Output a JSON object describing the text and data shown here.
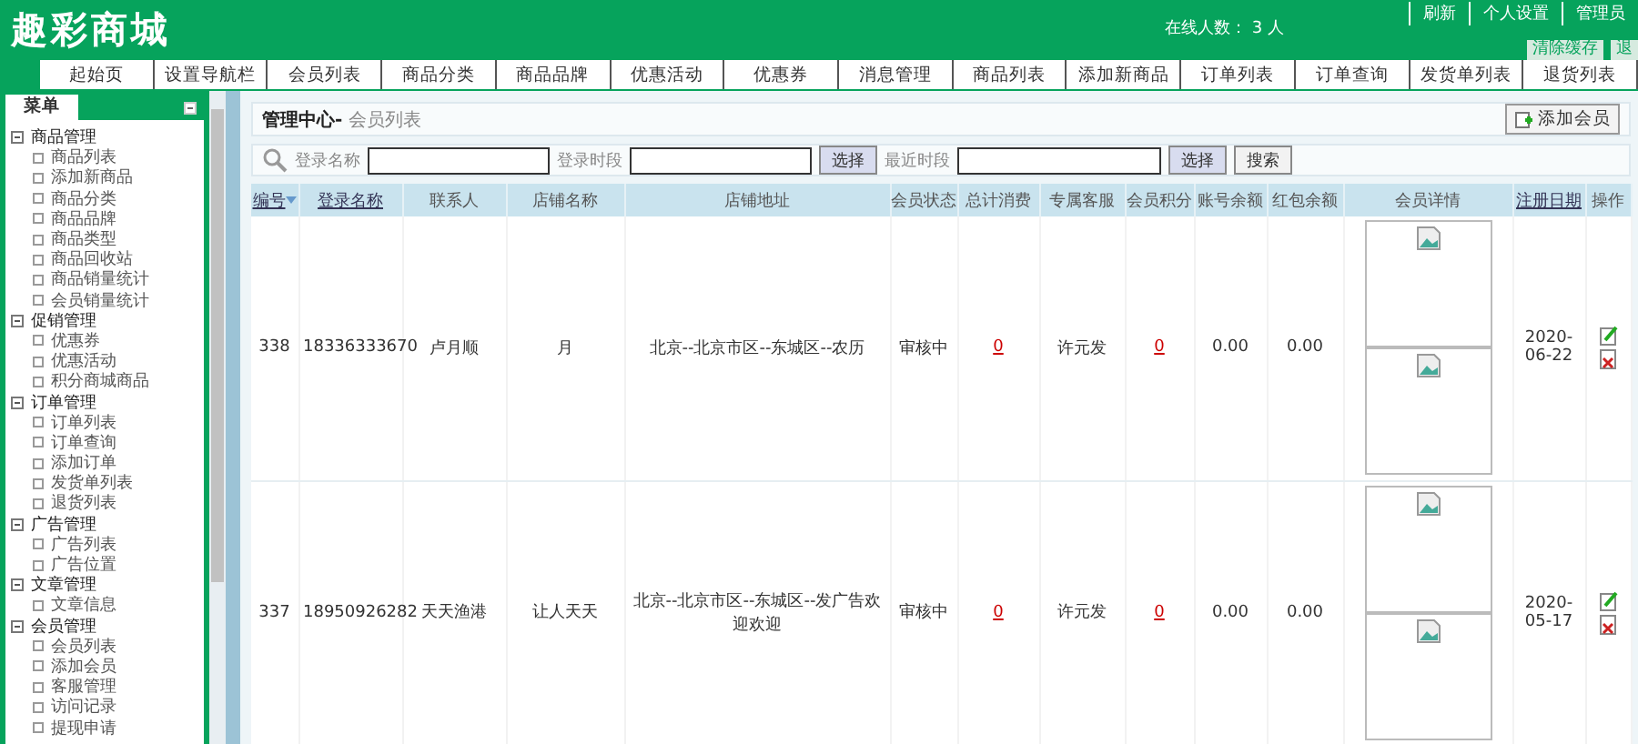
{
  "header": {
    "logo": "趣彩商城",
    "online": "在线人数： 3 人",
    "links": [
      "刷新",
      "个人设置",
      "管理员"
    ],
    "buttons": [
      "清除缓存",
      "退"
    ]
  },
  "nav": [
    "起始页",
    "设置导航栏",
    "会员列表",
    "商品分类",
    "商品品牌",
    "优惠活动",
    "优惠券",
    "消息管理",
    "商品列表",
    "添加新商品",
    "订单列表",
    "订单查询",
    "发货单列表",
    "退货列表"
  ],
  "sidebar": {
    "tab": "菜单",
    "groups": [
      {
        "label": "商品管理",
        "expanded": true,
        "children": [
          {
            "label": "商品列表"
          },
          {
            "label": "添加新商品"
          },
          {
            "label": "商品分类"
          },
          {
            "label": "商品品牌"
          },
          {
            "label": "商品类型"
          },
          {
            "label": "商品回收站"
          },
          {
            "label": "商品销量统计"
          },
          {
            "label": "会员销量统计"
          }
        ]
      },
      {
        "label": "促销管理",
        "expanded": true,
        "children": [
          {
            "label": "优惠券"
          },
          {
            "label": "优惠活动"
          },
          {
            "label": "积分商城商品"
          }
        ]
      },
      {
        "label": "订单管理",
        "expanded": true,
        "children": [
          {
            "label": "订单列表"
          },
          {
            "label": "订单查询"
          },
          {
            "label": "添加订单"
          },
          {
            "label": "发货单列表"
          },
          {
            "label": "退货列表"
          }
        ]
      },
      {
        "label": "广告管理",
        "expanded": true,
        "children": [
          {
            "label": "广告列表"
          },
          {
            "label": "广告位置"
          }
        ]
      },
      {
        "label": "文章管理",
        "expanded": true,
        "children": [
          {
            "label": "文章信息"
          }
        ]
      },
      {
        "label": "会员管理",
        "expanded": true,
        "children": [
          {
            "label": "会员列表"
          },
          {
            "label": "添加会员"
          },
          {
            "label": "客服管理"
          },
          {
            "label": "访问记录"
          },
          {
            "label": "提现申请"
          }
        ]
      }
    ]
  },
  "breadcrumb": {
    "root": "管理中心-",
    "current": "会员列表"
  },
  "add_button": "添加会员",
  "search": [
    {
      "kind": "label",
      "text": "登录名称"
    },
    {
      "kind": "input",
      "wide": true
    },
    {
      "kind": "label",
      "text": "登录时段"
    },
    {
      "kind": "input",
      "wide": true
    },
    {
      "kind": "pick",
      "text": "选择"
    },
    {
      "kind": "label",
      "text": "最近时段"
    },
    {
      "kind": "input",
      "wide": false
    },
    {
      "kind": "pick",
      "text": "选择"
    },
    {
      "kind": "submit",
      "text": "搜索"
    }
  ],
  "columns": [
    {
      "label": "编号",
      "link": true,
      "sorted": true
    },
    {
      "label": "登录名称",
      "link": true,
      "sorted": false
    },
    {
      "label": "联系人",
      "link": false,
      "sorted": false
    },
    {
      "label": "店铺名称",
      "link": false,
      "sorted": false
    },
    {
      "label": "店铺地址",
      "link": false,
      "sorted": false
    },
    {
      "label": "会员状态",
      "link": false,
      "sorted": false
    },
    {
      "label": "总计消费",
      "link": false,
      "sorted": false
    },
    {
      "label": "专属客服",
      "link": false,
      "sorted": false
    },
    {
      "label": "会员积分",
      "link": false,
      "sorted": false
    },
    {
      "label": "账号余额",
      "link": false,
      "sorted": false
    },
    {
      "label": "红包余额",
      "link": false,
      "sorted": false
    },
    {
      "label": "会员详情",
      "link": false,
      "sorted": false
    },
    {
      "label": "注册日期",
      "link": true,
      "sorted": false
    },
    {
      "label": "操作",
      "link": false,
      "sorted": false
    }
  ],
  "rows": [
    {
      "id": "338",
      "login": "18336333670",
      "contact": "卢月顺",
      "shop": "月",
      "address": "北京--北京市区--东城区--农历",
      "status": "审核中",
      "spend": "0",
      "service": "许元发",
      "points": "0",
      "balance": "0.00",
      "red": "0.00",
      "date": "2020-06-22"
    },
    {
      "id": "337",
      "login": "18950926282",
      "contact": "天天渔港",
      "shop": "让人天天",
      "address": "北京--北京市区--东城区--发广告欢迎欢迎",
      "status": "审核中",
      "spend": "0",
      "service": "许元发",
      "points": "0",
      "balance": "0.00",
      "red": "0.00",
      "date": "2020-05-17"
    }
  ]
}
